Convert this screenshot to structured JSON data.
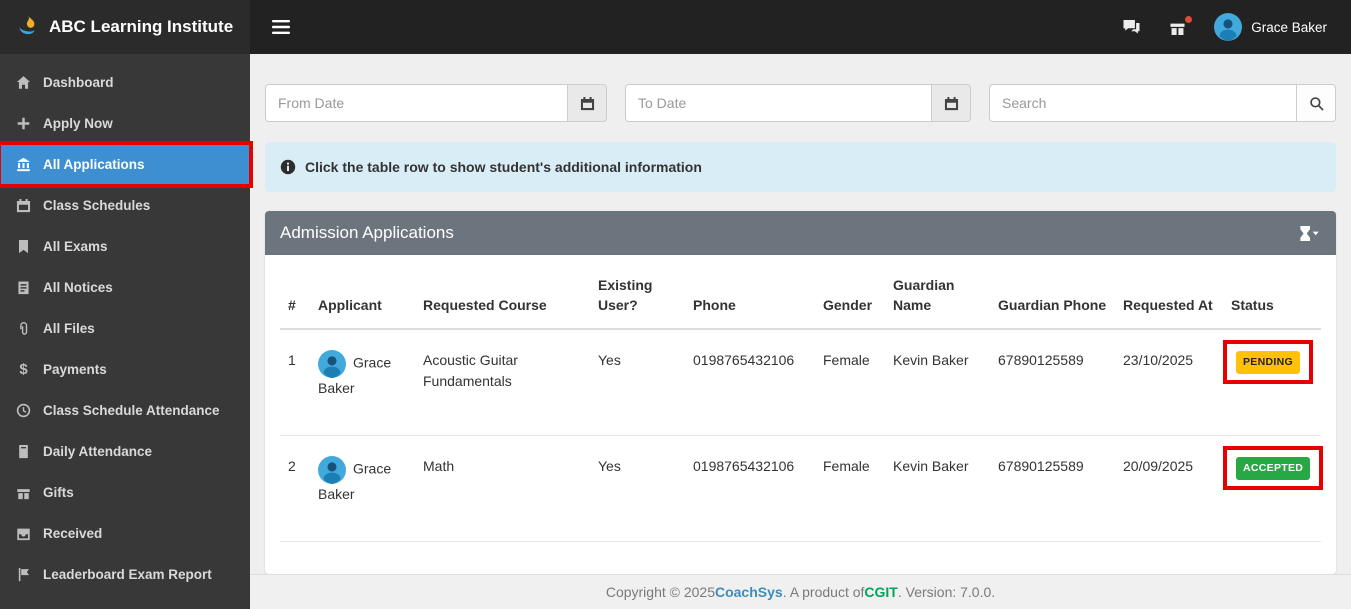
{
  "topbar": {
    "brand": "ABC Learning Institute",
    "user_name": "Grace Baker"
  },
  "sidebar": {
    "items": [
      {
        "label": "Dashboard",
        "icon": "home-icon"
      },
      {
        "label": "Apply Now",
        "icon": "plus-icon"
      },
      {
        "label": "All Applications",
        "icon": "bank-icon",
        "active": true
      },
      {
        "label": "Class Schedules",
        "icon": "calendar-icon"
      },
      {
        "label": "All Exams",
        "icon": "book-icon"
      },
      {
        "label": "All Notices",
        "icon": "clipboard-icon"
      },
      {
        "label": "All Files",
        "icon": "paperclip-icon"
      },
      {
        "label": "Payments",
        "icon": "dollar-icon"
      },
      {
        "label": "Class Schedule Attendance",
        "icon": "clock-icon"
      },
      {
        "label": "Daily Attendance",
        "icon": "notebook-icon"
      },
      {
        "label": "Gifts",
        "icon": "gift-icon"
      },
      {
        "label": "Received",
        "icon": "inbox-icon"
      },
      {
        "label": "Leaderboard Exam Report",
        "icon": "flag-icon"
      }
    ]
  },
  "filters": {
    "from_date_placeholder": "From Date",
    "to_date_placeholder": "To Date",
    "search_placeholder": "Search"
  },
  "alert": {
    "text": "Click the table row to show student's additional information"
  },
  "panel": {
    "title": "Admission Applications"
  },
  "table": {
    "headers": [
      "#",
      "Applicant",
      "Requested Course",
      "Existing User?",
      "Phone",
      "Gender",
      "Guardian Name",
      "Guardian Phone",
      "Requested At",
      "Status"
    ],
    "rows": [
      {
        "num": "1",
        "applicant": "Grace Baker",
        "course": "Acoustic Guitar Fundamentals",
        "existing_user": "Yes",
        "phone": "0198765432106",
        "gender": "Female",
        "guardian_name": "Kevin Baker",
        "guardian_phone": "67890125589",
        "requested_at": "23/10/2025",
        "status": "PENDING",
        "status_bg": "#ffc107",
        "status_text": "#212529"
      },
      {
        "num": "2",
        "applicant": "Grace Baker",
        "course": "Math",
        "existing_user": "Yes",
        "phone": "0198765432106",
        "gender": "Female",
        "guardian_name": "Kevin Baker",
        "guardian_phone": "67890125589",
        "requested_at": "20/09/2025",
        "status": "ACCEPTED",
        "status_bg": "#28a745",
        "status_text": "#ffffff"
      }
    ]
  },
  "footer": {
    "prefix": "Copyright © 2025 ",
    "brand": "CoachSys",
    "middle": ". A product of ",
    "product": "CGIT",
    "suffix": ". Version: 7.0.0."
  },
  "icons": {
    "dollar": "$"
  },
  "colors": {
    "sidebar_active": "#3d8fd1",
    "annotation_red": "#e60000",
    "coachsys_blue": "#3c8dbc",
    "cgit_green": "#00a65a"
  }
}
